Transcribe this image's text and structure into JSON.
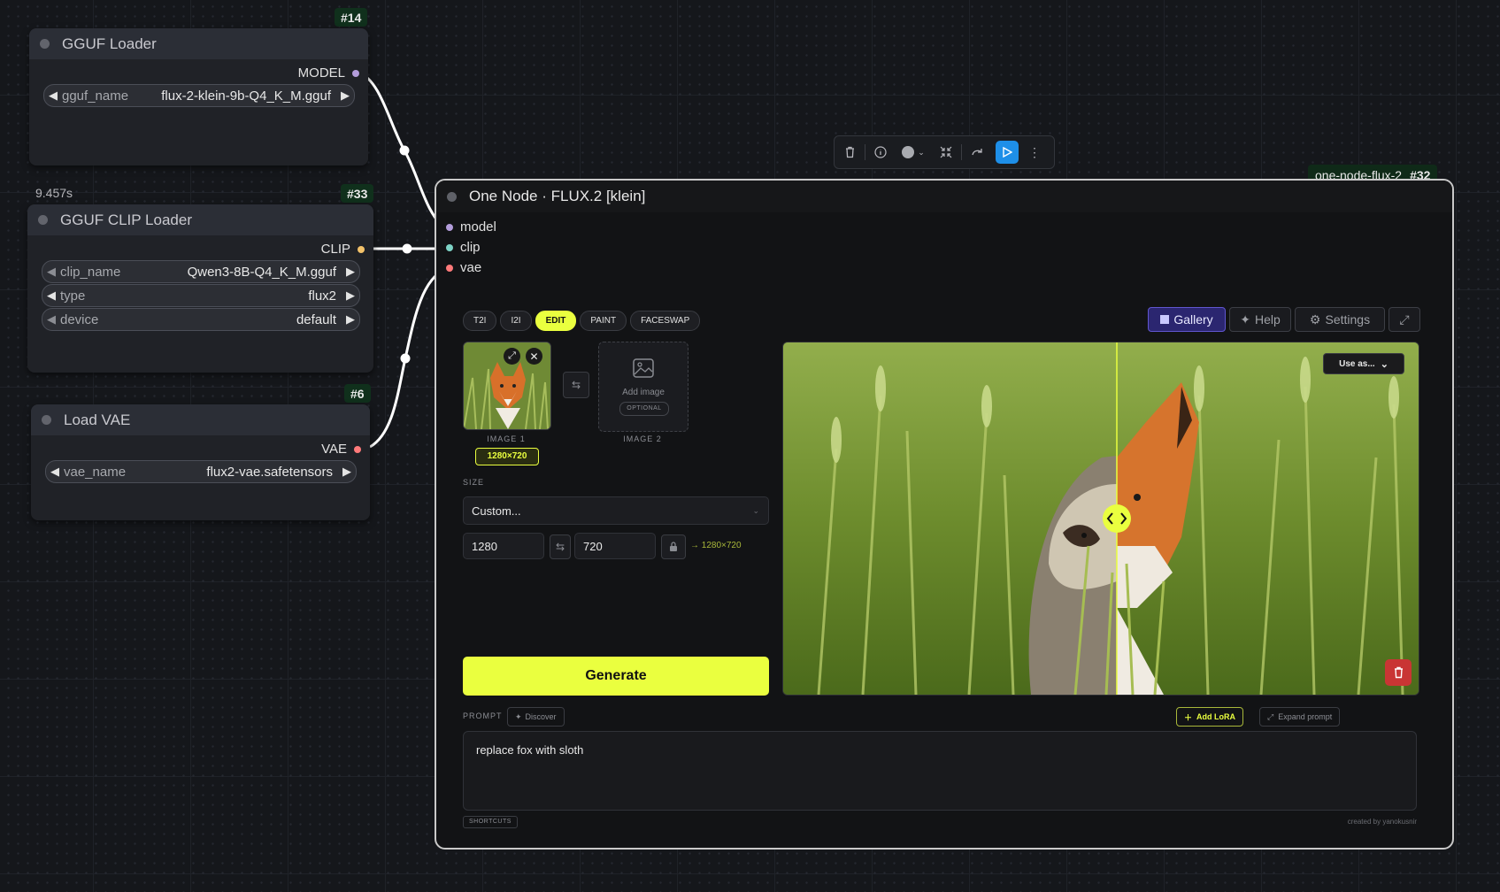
{
  "nodes": {
    "gguf_loader": {
      "badge": "#14",
      "title": "GGUF Loader",
      "output": "MODEL",
      "widget_label": "gguf_name",
      "widget_value": "flux-2-klein-9b-Q4_K_M.gguf"
    },
    "clip_loader": {
      "timing": "9.457s",
      "badge": "#33",
      "title": "GGUF CLIP Loader",
      "output": "CLIP",
      "widgets": [
        {
          "label": "clip_name",
          "value": "Qwen3-8B-Q4_K_M.gguf"
        },
        {
          "label": "type",
          "value": "flux2"
        },
        {
          "label": "device",
          "value": "default"
        }
      ]
    },
    "vae_loader": {
      "badge": "#6",
      "title": "Load VAE",
      "output": "VAE",
      "widget_label": "vae_name",
      "widget_value": "flux2-vae.safetensors"
    }
  },
  "main_node": {
    "tag": "one-node-flux-2",
    "badge": "#32",
    "title": "One Node · FLUX.2 [klein]",
    "inputs": [
      "model",
      "clip",
      "vae"
    ],
    "tabs": [
      "T2I",
      "I2I",
      "EDIT",
      "PAINT",
      "FACESWAP"
    ],
    "active_tab": "EDIT",
    "right_buttons": {
      "gallery": "Gallery",
      "help": "Help",
      "settings": "Settings"
    },
    "image1": {
      "label": "IMAGE 1",
      "size": "1280×720"
    },
    "image2": {
      "add": "Add image",
      "optional": "OPTIONAL",
      "label": "IMAGE 2"
    },
    "size": {
      "label": "SIZE",
      "preset": "Custom...",
      "width": "1280",
      "height": "720",
      "result": "→ 1280×720"
    },
    "generate": "Generate",
    "preview": {
      "use_as": "Use as..."
    },
    "prompt": {
      "label": "PROMPT",
      "discover": "Discover",
      "add_lora": "Add LoRA",
      "expand": "Expand prompt",
      "text": "replace fox with sloth",
      "shortcuts": "SHORTCUTS",
      "credit": "created by yanokusnir"
    }
  },
  "colors": {
    "accent": "#eaff3f",
    "model": "#b39ddb",
    "clip": "#f3c26a",
    "vae": "#ff7a7a",
    "run": "#1e8fe8"
  }
}
